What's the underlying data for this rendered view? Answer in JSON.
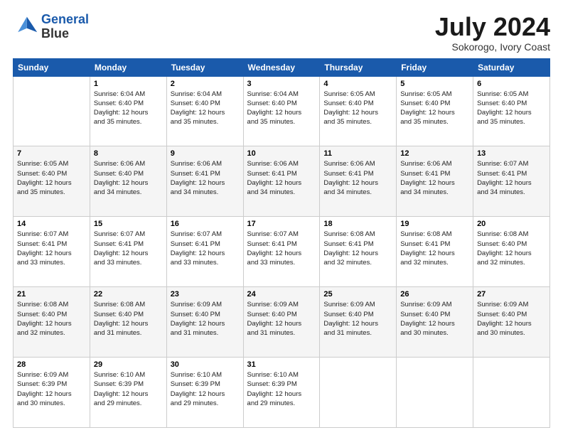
{
  "header": {
    "logo_line1": "General",
    "logo_line2": "Blue",
    "title": "July 2024",
    "subtitle": "Sokorogo, Ivory Coast"
  },
  "calendar": {
    "days_of_week": [
      "Sunday",
      "Monday",
      "Tuesday",
      "Wednesday",
      "Thursday",
      "Friday",
      "Saturday"
    ],
    "weeks": [
      [
        {
          "day": "",
          "info": ""
        },
        {
          "day": "1",
          "info": "Sunrise: 6:04 AM\nSunset: 6:40 PM\nDaylight: 12 hours\nand 35 minutes."
        },
        {
          "day": "2",
          "info": "Sunrise: 6:04 AM\nSunset: 6:40 PM\nDaylight: 12 hours\nand 35 minutes."
        },
        {
          "day": "3",
          "info": "Sunrise: 6:04 AM\nSunset: 6:40 PM\nDaylight: 12 hours\nand 35 minutes."
        },
        {
          "day": "4",
          "info": "Sunrise: 6:05 AM\nSunset: 6:40 PM\nDaylight: 12 hours\nand 35 minutes."
        },
        {
          "day": "5",
          "info": "Sunrise: 6:05 AM\nSunset: 6:40 PM\nDaylight: 12 hours\nand 35 minutes."
        },
        {
          "day": "6",
          "info": "Sunrise: 6:05 AM\nSunset: 6:40 PM\nDaylight: 12 hours\nand 35 minutes."
        }
      ],
      [
        {
          "day": "7",
          "info": "Sunrise: 6:05 AM\nSunset: 6:40 PM\nDaylight: 12 hours\nand 35 minutes."
        },
        {
          "day": "8",
          "info": "Sunrise: 6:06 AM\nSunset: 6:40 PM\nDaylight: 12 hours\nand 34 minutes."
        },
        {
          "day": "9",
          "info": "Sunrise: 6:06 AM\nSunset: 6:41 PM\nDaylight: 12 hours\nand 34 minutes."
        },
        {
          "day": "10",
          "info": "Sunrise: 6:06 AM\nSunset: 6:41 PM\nDaylight: 12 hours\nand 34 minutes."
        },
        {
          "day": "11",
          "info": "Sunrise: 6:06 AM\nSunset: 6:41 PM\nDaylight: 12 hours\nand 34 minutes."
        },
        {
          "day": "12",
          "info": "Sunrise: 6:06 AM\nSunset: 6:41 PM\nDaylight: 12 hours\nand 34 minutes."
        },
        {
          "day": "13",
          "info": "Sunrise: 6:07 AM\nSunset: 6:41 PM\nDaylight: 12 hours\nand 34 minutes."
        }
      ],
      [
        {
          "day": "14",
          "info": "Sunrise: 6:07 AM\nSunset: 6:41 PM\nDaylight: 12 hours\nand 33 minutes."
        },
        {
          "day": "15",
          "info": "Sunrise: 6:07 AM\nSunset: 6:41 PM\nDaylight: 12 hours\nand 33 minutes."
        },
        {
          "day": "16",
          "info": "Sunrise: 6:07 AM\nSunset: 6:41 PM\nDaylight: 12 hours\nand 33 minutes."
        },
        {
          "day": "17",
          "info": "Sunrise: 6:07 AM\nSunset: 6:41 PM\nDaylight: 12 hours\nand 33 minutes."
        },
        {
          "day": "18",
          "info": "Sunrise: 6:08 AM\nSunset: 6:41 PM\nDaylight: 12 hours\nand 32 minutes."
        },
        {
          "day": "19",
          "info": "Sunrise: 6:08 AM\nSunset: 6:41 PM\nDaylight: 12 hours\nand 32 minutes."
        },
        {
          "day": "20",
          "info": "Sunrise: 6:08 AM\nSunset: 6:40 PM\nDaylight: 12 hours\nand 32 minutes."
        }
      ],
      [
        {
          "day": "21",
          "info": "Sunrise: 6:08 AM\nSunset: 6:40 PM\nDaylight: 12 hours\nand 32 minutes."
        },
        {
          "day": "22",
          "info": "Sunrise: 6:08 AM\nSunset: 6:40 PM\nDaylight: 12 hours\nand 31 minutes."
        },
        {
          "day": "23",
          "info": "Sunrise: 6:09 AM\nSunset: 6:40 PM\nDaylight: 12 hours\nand 31 minutes."
        },
        {
          "day": "24",
          "info": "Sunrise: 6:09 AM\nSunset: 6:40 PM\nDaylight: 12 hours\nand 31 minutes."
        },
        {
          "day": "25",
          "info": "Sunrise: 6:09 AM\nSunset: 6:40 PM\nDaylight: 12 hours\nand 31 minutes."
        },
        {
          "day": "26",
          "info": "Sunrise: 6:09 AM\nSunset: 6:40 PM\nDaylight: 12 hours\nand 30 minutes."
        },
        {
          "day": "27",
          "info": "Sunrise: 6:09 AM\nSunset: 6:40 PM\nDaylight: 12 hours\nand 30 minutes."
        }
      ],
      [
        {
          "day": "28",
          "info": "Sunrise: 6:09 AM\nSunset: 6:39 PM\nDaylight: 12 hours\nand 30 minutes."
        },
        {
          "day": "29",
          "info": "Sunrise: 6:10 AM\nSunset: 6:39 PM\nDaylight: 12 hours\nand 29 minutes."
        },
        {
          "day": "30",
          "info": "Sunrise: 6:10 AM\nSunset: 6:39 PM\nDaylight: 12 hours\nand 29 minutes."
        },
        {
          "day": "31",
          "info": "Sunrise: 6:10 AM\nSunset: 6:39 PM\nDaylight: 12 hours\nand 29 minutes."
        },
        {
          "day": "",
          "info": ""
        },
        {
          "day": "",
          "info": ""
        },
        {
          "day": "",
          "info": ""
        }
      ]
    ]
  }
}
